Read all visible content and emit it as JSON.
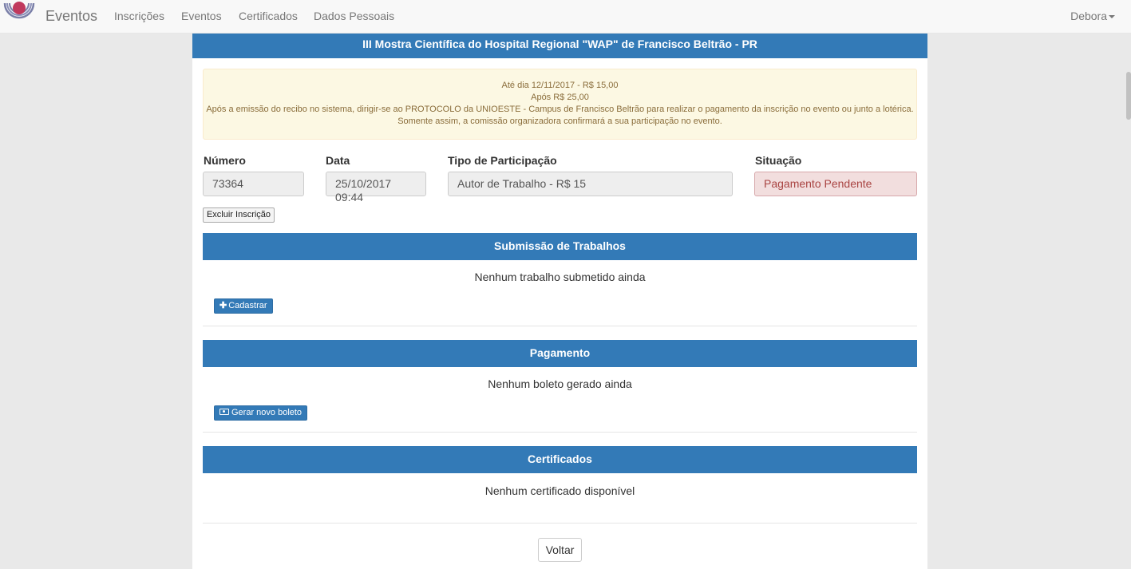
{
  "navbar": {
    "brand": "Eventos",
    "links": [
      "Inscrições",
      "Eventos",
      "Certificados",
      "Dados Pessoais"
    ],
    "user": "Debora"
  },
  "event": {
    "title": "III Mostra Científica do Hospital Regional \"WAP\" de Francisco Beltrão - PR"
  },
  "alert": {
    "line1": "Até dia 12/11/2017 - R$ 15,00",
    "line2": "Após R$ 25,00",
    "line3": "Após a emissão do recibo no sistema, dirigir-se ao PROTOCOLO da UNIOESTE - Campus de Francisco Beltrão para realizar o pagamento da inscrição no evento ou junto a lotérica.",
    "line4": "Somente assim, a comissão organizadora confirmará a sua participação no evento."
  },
  "fields": {
    "numero_label": "Número",
    "numero_value": "73364",
    "data_label": "Data",
    "data_value": "25/10/2017 09:44",
    "tipo_label": "Tipo de Participação",
    "tipo_value": "Autor de Trabalho - R$ 15",
    "situacao_label": "Situação",
    "situacao_value": "Pagamento Pendente"
  },
  "actions": {
    "excluir": "Excluir Inscrição",
    "voltar": "Voltar"
  },
  "submissao": {
    "header": "Submissão de Trabalhos",
    "empty": "Nenhum trabalho submetido ainda",
    "button": "Cadastrar"
  },
  "pagamento": {
    "header": "Pagamento",
    "empty": "Nenhum boleto gerado ainda",
    "button": "Gerar novo boleto"
  },
  "certificados": {
    "header": "Certificados",
    "empty": "Nenhum certificado disponível"
  },
  "colors": {
    "primary": "#337ab7",
    "warning_bg": "#fcf8e3",
    "danger_bg": "#f2dede",
    "danger_text": "#a94442",
    "logo": "#9b2c4d"
  },
  "icons": {
    "plus": "plus-icon",
    "money": "money-icon",
    "caret": "caret-down-icon",
    "logo": "unioeste-logo"
  }
}
